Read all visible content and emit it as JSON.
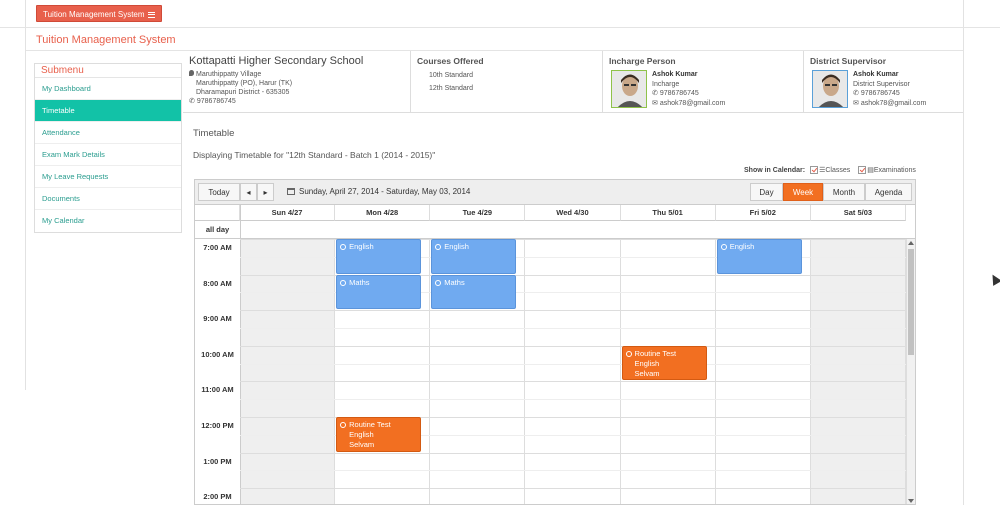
{
  "app": {
    "top_button": "Tuition Management System",
    "brand": "Tuition Management System"
  },
  "sidebar": {
    "title": "Submenu",
    "items": [
      {
        "label": "My Dashboard"
      },
      {
        "label": "Timetable"
      },
      {
        "label": "Attendance"
      },
      {
        "label": "Exam Mark Details"
      },
      {
        "label": "My Leave Requests"
      },
      {
        "label": "Documents"
      },
      {
        "label": "My Calendar"
      }
    ]
  },
  "school": {
    "name": "Kottapatti Higher Secondary School",
    "address1": "Maruthippatty Village",
    "address2": "Maruthippatty (PO), Harur (TK)",
    "address3": "Dharamapuri District - 635305",
    "phone": "9786786745"
  },
  "courses": {
    "title": "Courses Offered",
    "items": [
      "10th Standard",
      "12th Standard"
    ]
  },
  "incharge": {
    "title": "Incharge Person",
    "name": "Ashok Kumar",
    "role": "Incharge",
    "phone": "9786786745",
    "email": "ashok78@gmail.com"
  },
  "district": {
    "title": "District Supervisor",
    "name": "Ashok Kumar",
    "role": "District Supervisor",
    "phone": "9786786745",
    "email": "ashok78@gmail.com"
  },
  "main": {
    "title": "Timetable",
    "subtitle": "Displaying Timetable for \"12th Standard - Batch 1 (2014 - 2015)\"",
    "show_in_calendar": "Show in Calendar:",
    "classes_label": "Classes",
    "exams_label": "Examinations"
  },
  "calendar": {
    "today": "Today",
    "prev": "◂",
    "next": "▸",
    "range": "Sunday, April 27, 2014 - Saturday, May 03, 2014",
    "views": [
      "Day",
      "Week",
      "Month",
      "Agenda"
    ],
    "active_view": "Week",
    "allday": "all day",
    "days": [
      "Sun 4/27",
      "Mon 4/28",
      "Tue 4/29",
      "Wed 4/30",
      "Thu 5/01",
      "Fri 5/02",
      "Sat 5/03"
    ],
    "hours": [
      "7:00 AM",
      "8:00 AM",
      "9:00 AM",
      "10:00 AM",
      "11:00 AM",
      "12:00 PM",
      "1:00 PM",
      "2:00 PM"
    ],
    "events": [
      {
        "title": "English",
        "day": "Mon 4/28",
        "start": "7:00 AM",
        "type": "class"
      },
      {
        "title": "English",
        "day": "Tue 4/29",
        "start": "7:00 AM",
        "type": "class"
      },
      {
        "title": "English",
        "day": "Fri 5/02",
        "start": "7:00 AM",
        "type": "class"
      },
      {
        "title": "Maths",
        "day": "Mon 4/28",
        "start": "8:00 AM",
        "type": "class"
      },
      {
        "title": "Maths",
        "day": "Tue 4/29",
        "start": "8:00 AM",
        "type": "class"
      },
      {
        "title": "Routine Test",
        "line2": "English",
        "line3": "Selvam",
        "day": "Thu 5/01",
        "start": "10:00 AM",
        "type": "exam"
      },
      {
        "title": "Routine Test",
        "line2": "English",
        "line3": "Selvam",
        "day": "Mon 4/28",
        "start": "12:00 PM",
        "type": "exam"
      }
    ]
  }
}
